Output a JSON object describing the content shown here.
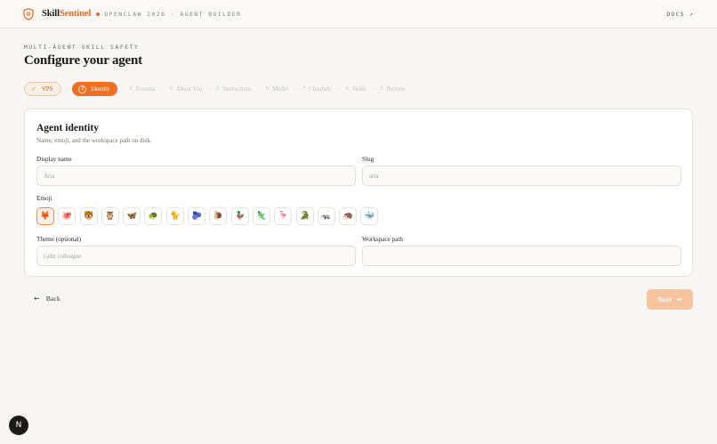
{
  "header": {
    "brand_left": "Skill",
    "brand_right": "Sentinel",
    "breadcrumb": "OPENCLAW 2026 · AGENT BUILDER",
    "docs_label": "DOCS ↗"
  },
  "page": {
    "eyebrow": "MULTI-AGENT SKILL SAFETY",
    "title": "Configure your agent"
  },
  "steps": [
    {
      "num": "✓",
      "label": "VPS",
      "state": "done"
    },
    {
      "num": "2",
      "label": "Identity",
      "state": "active"
    },
    {
      "num": "3",
      "label": "Persona",
      "state": "upcoming"
    },
    {
      "num": "4",
      "label": "About You",
      "state": "upcoming"
    },
    {
      "num": "5",
      "label": "Instructions",
      "state": "upcoming"
    },
    {
      "num": "6",
      "label": "Model",
      "state": "upcoming"
    },
    {
      "num": "7",
      "label": "Channels",
      "state": "upcoming"
    },
    {
      "num": "8",
      "label": "Skills",
      "state": "upcoming"
    },
    {
      "num": "9",
      "label": "Review",
      "state": "upcoming"
    }
  ],
  "card": {
    "title": "Agent identity",
    "subtitle": "Name, emoji, and the workspace path on disk.",
    "display_name_label": "Display name",
    "display_name_placeholder": "Aria",
    "slug_label": "Slug",
    "slug_placeholder": "aria",
    "emoji_label": "Emoji",
    "emojis": [
      "🦊",
      "🐙",
      "🐯",
      "🦉",
      "🦋",
      "🐢",
      "🐈",
      "🫐",
      "🐌",
      "🦆",
      "🦎",
      "🦩",
      "🐊",
      "🦡",
      "🦔",
      "🐳"
    ],
    "selected_emoji_index": 0,
    "theme_label": "Theme (optional)",
    "theme_placeholder": "calm colleague",
    "workspace_label": "Workspace path",
    "workspace_value": ""
  },
  "nav": {
    "back_label": "Back",
    "next_label": "Next"
  },
  "fab": {
    "label": "N"
  },
  "colors": {
    "accent": "#ec6f22",
    "accent_soft": "#f7c4a0"
  }
}
